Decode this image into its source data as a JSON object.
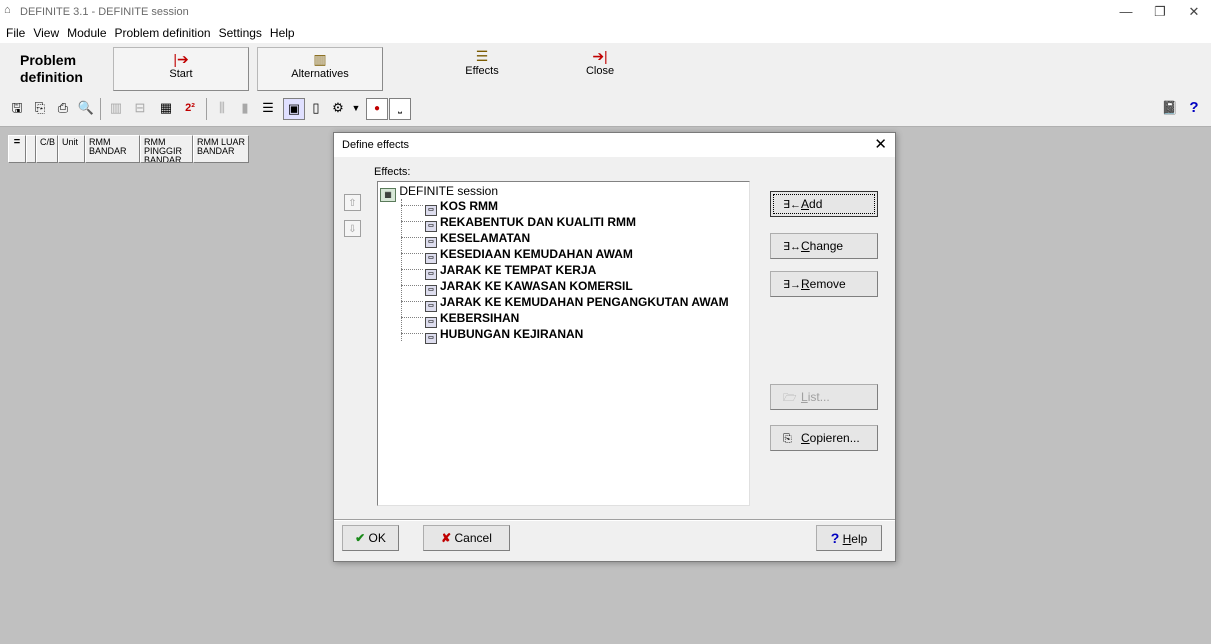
{
  "window": {
    "title": "DEFINITE 3.1 - DEFINITE session",
    "minimize_glyph": "—",
    "maximize_glyph": "❐",
    "close_glyph": "✕",
    "app_icon": "house-icon"
  },
  "menu": [
    "File",
    "View",
    "Module",
    "Problem definition",
    "Settings",
    "Help"
  ],
  "big_toolbar": {
    "section_label_line1": "Problem",
    "section_label_line2": "definition",
    "buttons": [
      {
        "label": "Start",
        "icon": "start-arrow-icon"
      },
      {
        "label": "Alternatives",
        "icon": "alternatives-icon"
      },
      {
        "label": "Effects",
        "icon": "effects-icon"
      },
      {
        "label": "Close",
        "icon": "close-arrow-icon"
      }
    ]
  },
  "grid": {
    "headers": [
      "C/B",
      "Unit",
      "RMM BANDAR",
      "RMM PINGGIR BANDAR",
      "RMM LUAR BANDAR"
    ]
  },
  "dialog": {
    "title": "Define effects",
    "effects_label": "Effects:",
    "root_label": "DEFINITE session",
    "effects": [
      "KOS RMM",
      "REKABENTUK DAN KUALITI RMM",
      "KESELAMATAN",
      "KESEDIAAN KEMUDAHAN AWAM",
      "JARAK KE TEMPAT KERJA",
      "JARAK KE KAWASAN KOMERSIL",
      "JARAK KE KEMUDAHAN PENGANGKUTAN AWAM",
      "KEBERSIHAN",
      "HUBUNGAN KEJIRANAN"
    ],
    "buttons": {
      "add": {
        "mnemonic": "A",
        "rest": "dd"
      },
      "change": {
        "mnemonic": "C",
        "rest": "hange"
      },
      "remove": {
        "mnemonic": "R",
        "rest": "emove"
      },
      "list": {
        "mnemonic": "L",
        "rest": "ist..."
      },
      "copieren": {
        "mnemonic": "C",
        "rest": "opieren..."
      },
      "ok": "OK",
      "cancel": "Cancel",
      "help": {
        "mnemonic": "H",
        "rest": "elp"
      }
    }
  }
}
